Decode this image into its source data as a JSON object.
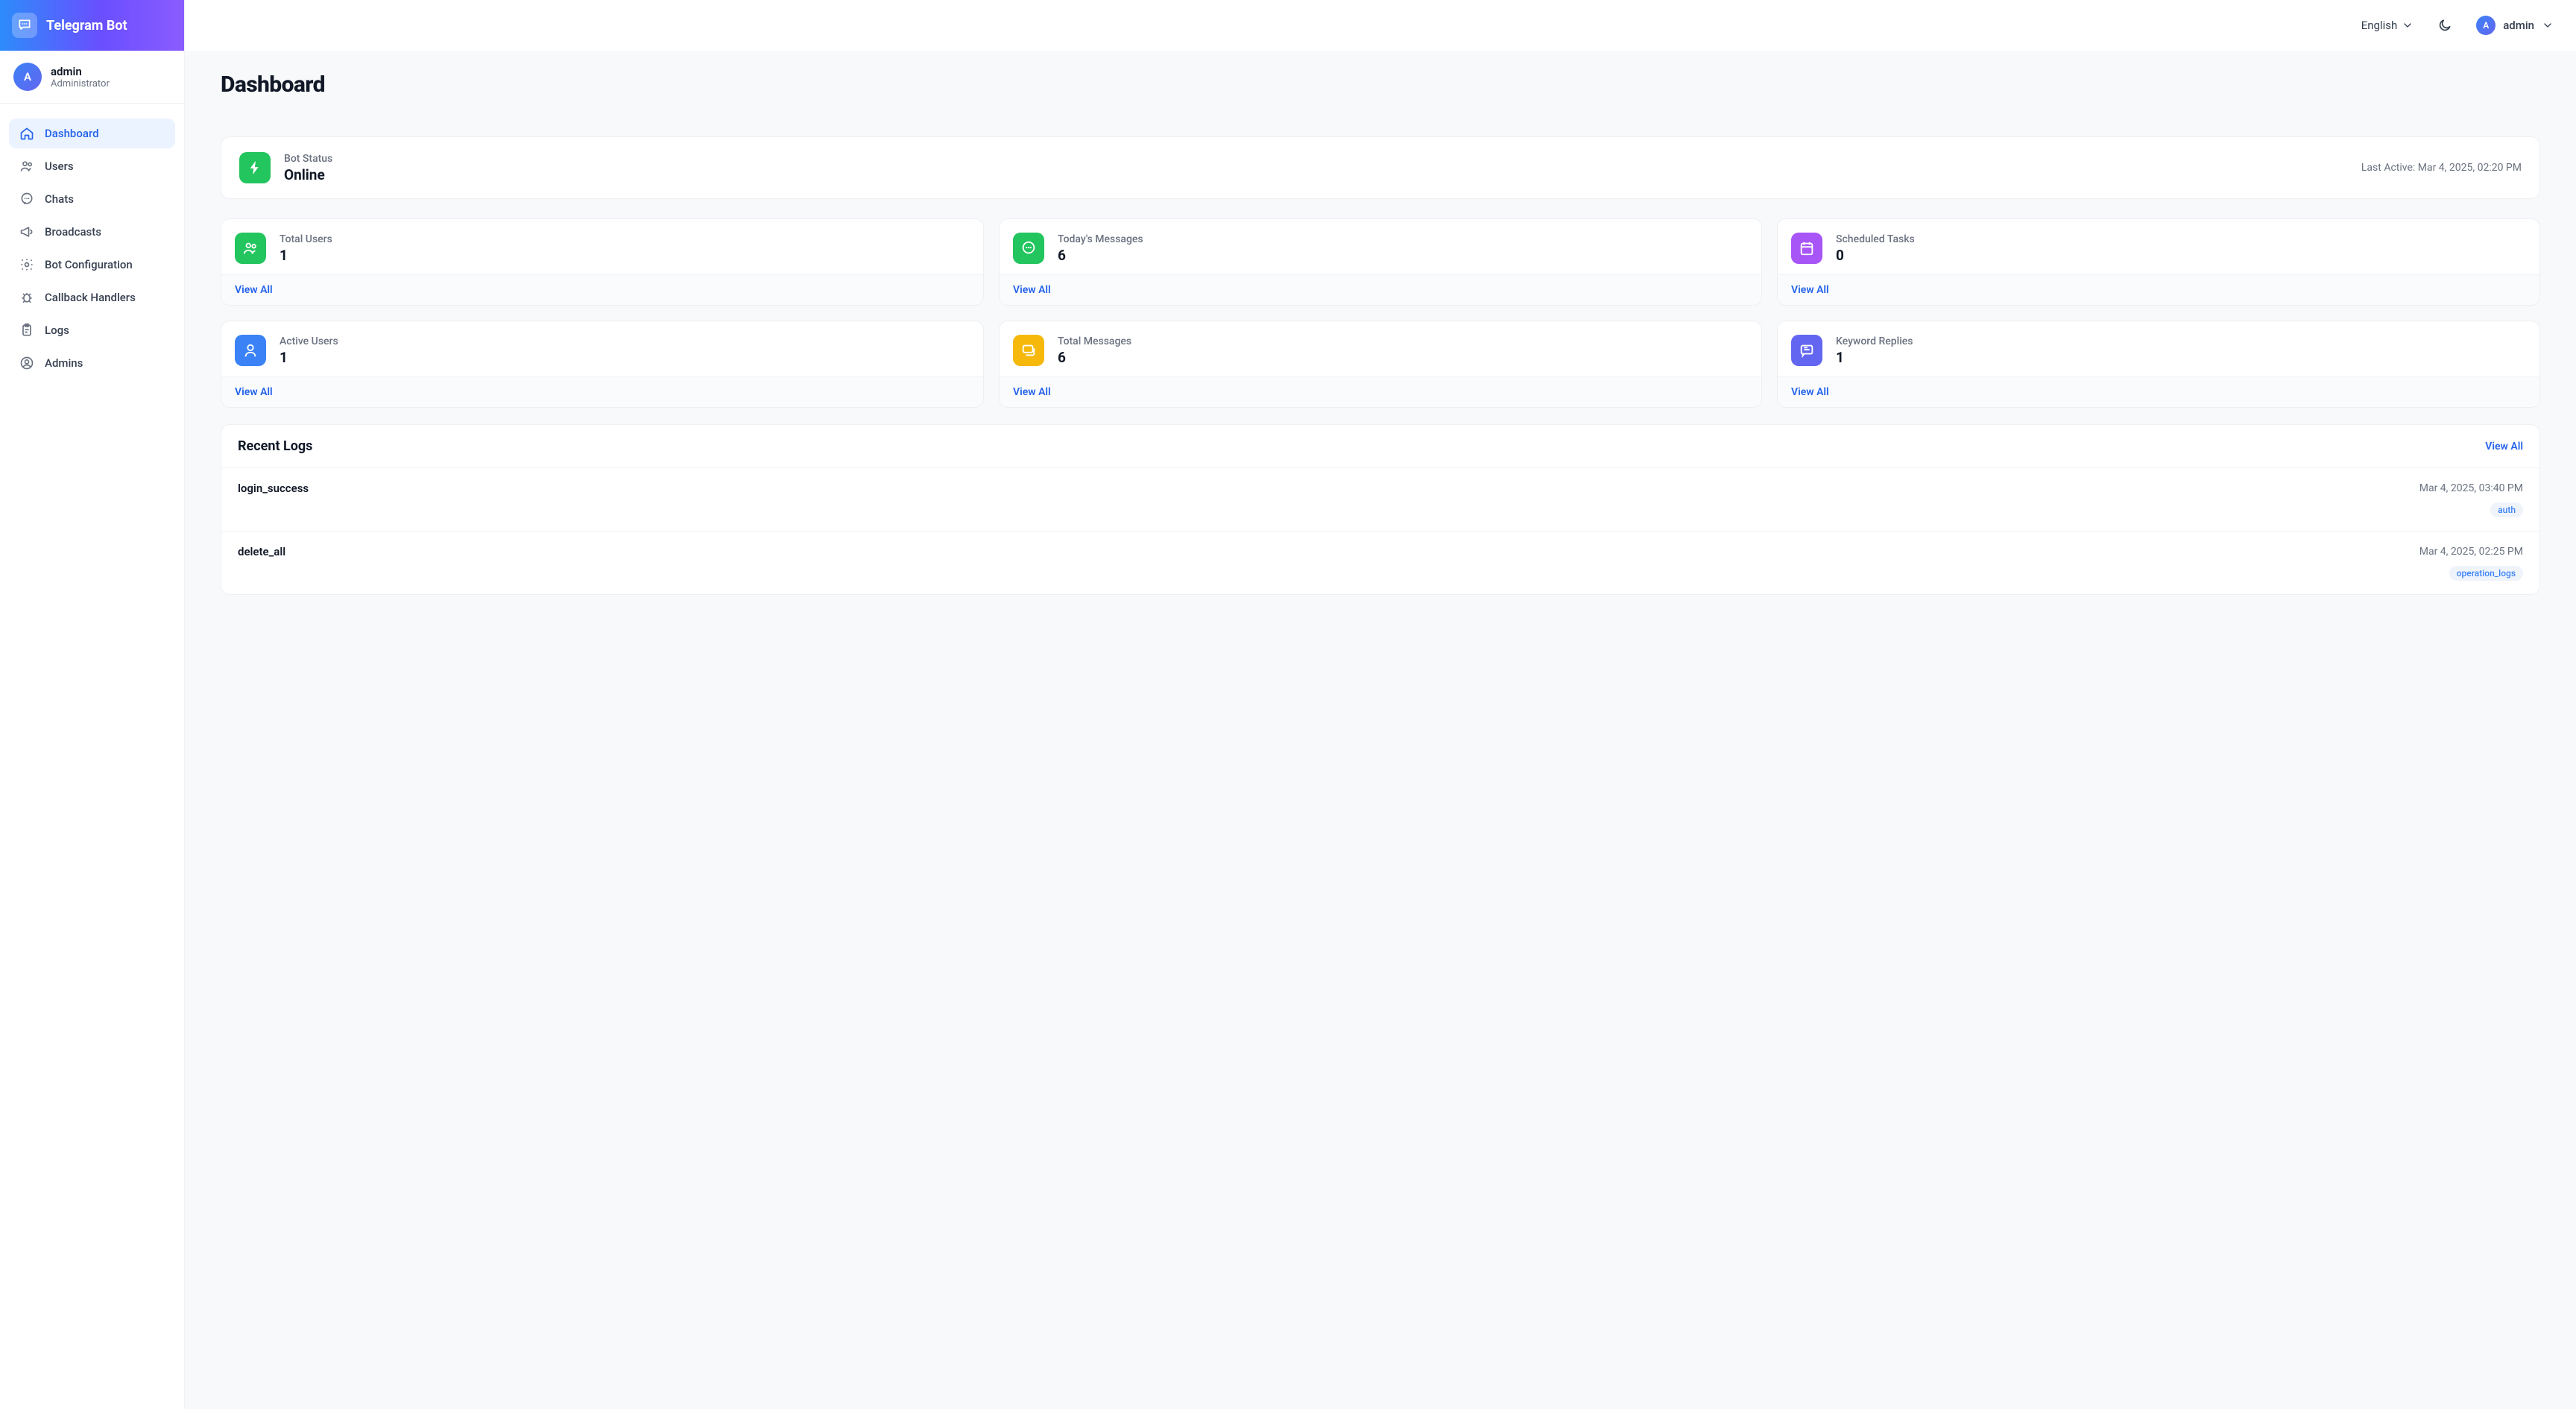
{
  "brand": {
    "title": "Telegram Bot"
  },
  "user": {
    "initial": "A",
    "name": "admin",
    "role": "Administrator"
  },
  "sidebar": [
    {
      "label": "Dashboard",
      "icon": "home",
      "active": true
    },
    {
      "label": "Users",
      "icon": "users",
      "active": false
    },
    {
      "label": "Chats",
      "icon": "chat",
      "active": false
    },
    {
      "label": "Broadcasts",
      "icon": "megaphone",
      "active": false
    },
    {
      "label": "Bot Configuration",
      "icon": "gear",
      "active": false
    },
    {
      "label": "Callback Handlers",
      "icon": "bug",
      "active": false
    },
    {
      "label": "Logs",
      "icon": "clipboard",
      "active": false
    },
    {
      "label": "Admins",
      "icon": "user-circle",
      "active": false
    }
  ],
  "topbar": {
    "language": "English",
    "user": "admin",
    "initial": "A"
  },
  "page": {
    "title": "Dashboard"
  },
  "status": {
    "label": "Bot Status",
    "value": "Online",
    "last_active": "Last Active: Mar 4, 2025, 02:20 PM"
  },
  "stats": [
    {
      "label": "Total Users",
      "value": "1",
      "icon": "users",
      "color": "ic-green"
    },
    {
      "label": "Today's Messages",
      "value": "6",
      "icon": "message",
      "color": "ic-green"
    },
    {
      "label": "Scheduled Tasks",
      "value": "0",
      "icon": "calendar",
      "color": "ic-purple"
    },
    {
      "label": "Active Users",
      "value": "1",
      "icon": "user",
      "color": "ic-blue"
    },
    {
      "label": "Total Messages",
      "value": "6",
      "icon": "messages",
      "color": "ic-yellow"
    },
    {
      "label": "Keyword Replies",
      "value": "1",
      "icon": "reply",
      "color": "ic-indigo"
    }
  ],
  "labels": {
    "view_all": "View All"
  },
  "recent_logs": {
    "title": "Recent Logs",
    "items": [
      {
        "action": "login_success",
        "time": "Mar 4, 2025, 03:40 PM",
        "tag": "auth"
      },
      {
        "action": "delete_all",
        "time": "Mar 4, 2025, 02:25 PM",
        "tag": "operation_logs"
      }
    ]
  }
}
